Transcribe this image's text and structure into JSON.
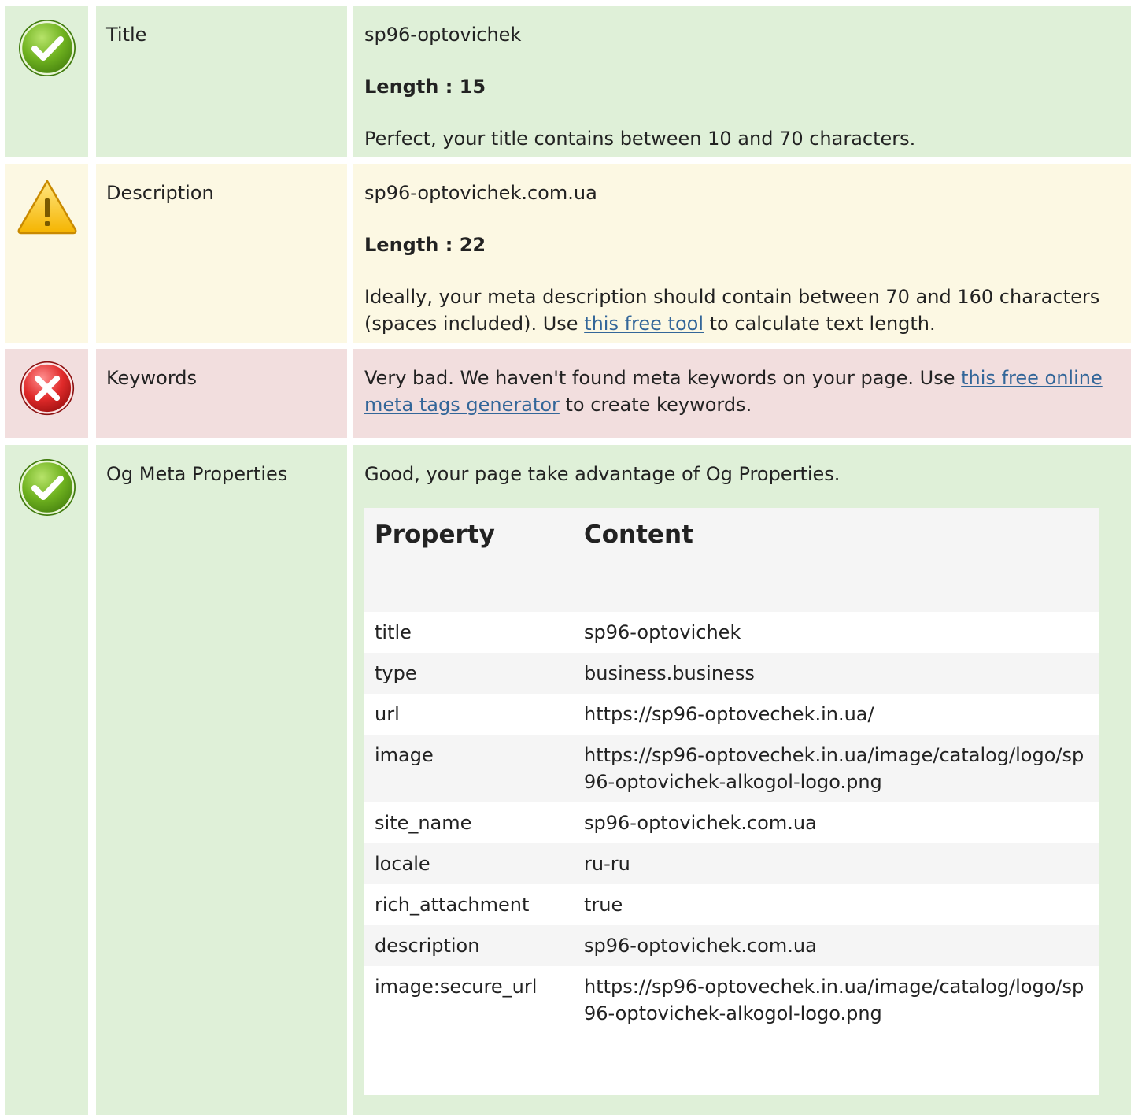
{
  "rows": {
    "title": {
      "label": "Title",
      "value": "sp96-optovichek",
      "length": "Length : 15",
      "message": "Perfect, your title contains between 10 and 70 characters."
    },
    "description": {
      "label": "Description",
      "value": "sp96-optovichek.com.ua",
      "length": "Length : 22",
      "message_before": "Ideally, your meta description should contain between 70 and 160 characters (spaces included). Use ",
      "link_text": "this free tool",
      "message_after": " to calculate text length."
    },
    "keywords": {
      "label": "Keywords",
      "message_before": "Very bad. We haven't found meta keywords on your page. Use ",
      "link_text": "this free online meta tags generator",
      "message_after": " to create keywords."
    },
    "og": {
      "label": "Og Meta Properties",
      "message": "Good, your page take advantage of Og Properties.",
      "table_headers": {
        "property": "Property",
        "content": "Content"
      },
      "properties": [
        {
          "property": "title",
          "content": "sp96-optovichek"
        },
        {
          "property": "type",
          "content": "business.business"
        },
        {
          "property": "url",
          "content": "https://sp96-optovechek.in.ua/"
        },
        {
          "property": "image",
          "content": "https://sp96-optovechek.in.ua/image/catalog/logo/sp96-optovichek-alkogol-logo.png"
        },
        {
          "property": "site_name",
          "content": "sp96-optovichek.com.ua"
        },
        {
          "property": "locale",
          "content": "ru-ru"
        },
        {
          "property": "rich_attachment",
          "content": "true"
        },
        {
          "property": "description",
          "content": "sp96-optovichek.com.ua"
        },
        {
          "property": "image:secure_url",
          "content": "https://sp96-optovechek.in.ua/image/catalog/logo/sp96-optovichek-alkogol-logo.png"
        }
      ]
    }
  },
  "colors": {
    "good_bg": "#dff0d8",
    "warn_bg": "#fcf8e3",
    "bad_bg": "#f2dede",
    "link": "#336699"
  },
  "icons": {
    "good": "check-circle-icon",
    "warn": "warning-triangle-icon",
    "bad": "error-x-circle-icon"
  }
}
